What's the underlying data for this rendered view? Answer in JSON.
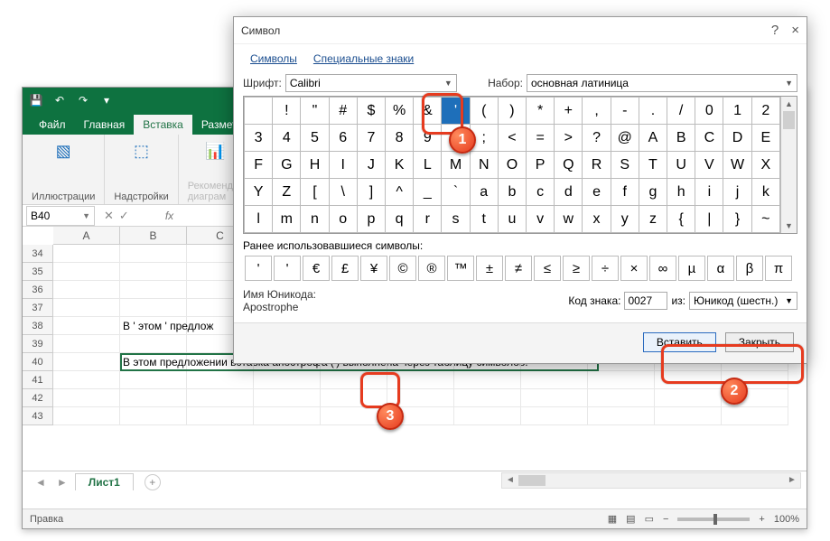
{
  "excel": {
    "tabs": {
      "file": "Файл",
      "home": "Главная",
      "insert": "Вставка",
      "layout": "Разметка стр"
    },
    "ribbon": {
      "illustrations": "Иллюстрации",
      "addins": "Надстройки",
      "recommended_top": "Рекомендуе",
      "recommended_bot": "диаграм"
    },
    "namebox": "B40",
    "fx": "fx",
    "rows": [
      "34",
      "35",
      "36",
      "37",
      "38",
      "39",
      "40",
      "41",
      "42",
      "43"
    ],
    "cols": [
      "A",
      "B",
      "C"
    ],
    "cell_b38": "В ' этом ' предлож",
    "cell_b40": "В этом предложении вставка апострофа (') выполнена через таблицу символов.",
    "sheet1": "Лист1",
    "status": "Правка",
    "zoom": "100%"
  },
  "dialog": {
    "title": "Символ",
    "help": "?",
    "close": "×",
    "tab_symbols": "Символы",
    "tab_special": "Специальные знаки",
    "font_label": "Шрифт:",
    "font_value": "Calibri",
    "subset_label": "Набор:",
    "subset_value": "основная латиница",
    "grid": [
      [
        "",
        "!",
        "\"",
        "#",
        "$",
        "%",
        "&",
        "'",
        "(",
        ")",
        "*",
        "+",
        ",",
        "-",
        ".",
        "/",
        "0",
        "1",
        "2"
      ],
      [
        "3",
        "4",
        "5",
        "6",
        "7",
        "8",
        "9",
        ":",
        ";",
        "<",
        "=",
        ">",
        "?",
        "@",
        "A",
        "B",
        "C",
        "D",
        "E"
      ],
      [
        "F",
        "G",
        "H",
        "I",
        "J",
        "K",
        "L",
        "M",
        "N",
        "O",
        "P",
        "Q",
        "R",
        "S",
        "T",
        "U",
        "V",
        "W",
        "X"
      ],
      [
        "Y",
        "Z",
        "[",
        "\\",
        "]",
        "^",
        "_",
        "`",
        "a",
        "b",
        "c",
        "d",
        "e",
        "f",
        "g",
        "h",
        "i",
        "j",
        "k"
      ],
      [
        "l",
        "m",
        "n",
        "o",
        "p",
        "q",
        "r",
        "s",
        "t",
        "u",
        "v",
        "w",
        "x",
        "y",
        "z",
        "{",
        "|",
        "}",
        "~"
      ]
    ],
    "selected_row": 0,
    "selected_col": 7,
    "recent_label": "Ранее использовавшиеся символы:",
    "recent": [
      "'",
      "'",
      "€",
      "£",
      "¥",
      "©",
      "®",
      "™",
      "±",
      "≠",
      "≤",
      "≥",
      "÷",
      "×",
      "∞",
      "µ",
      "α",
      "β",
      "π"
    ],
    "unicode_name_label": "Имя Юникода:",
    "unicode_name_value": "Apostrophe",
    "code_label": "Код знака:",
    "code_value": "0027",
    "from_label": "из:",
    "from_value": "Юникод (шестн.)",
    "btn_insert": "Вставить",
    "btn_close": "Закрыть"
  }
}
